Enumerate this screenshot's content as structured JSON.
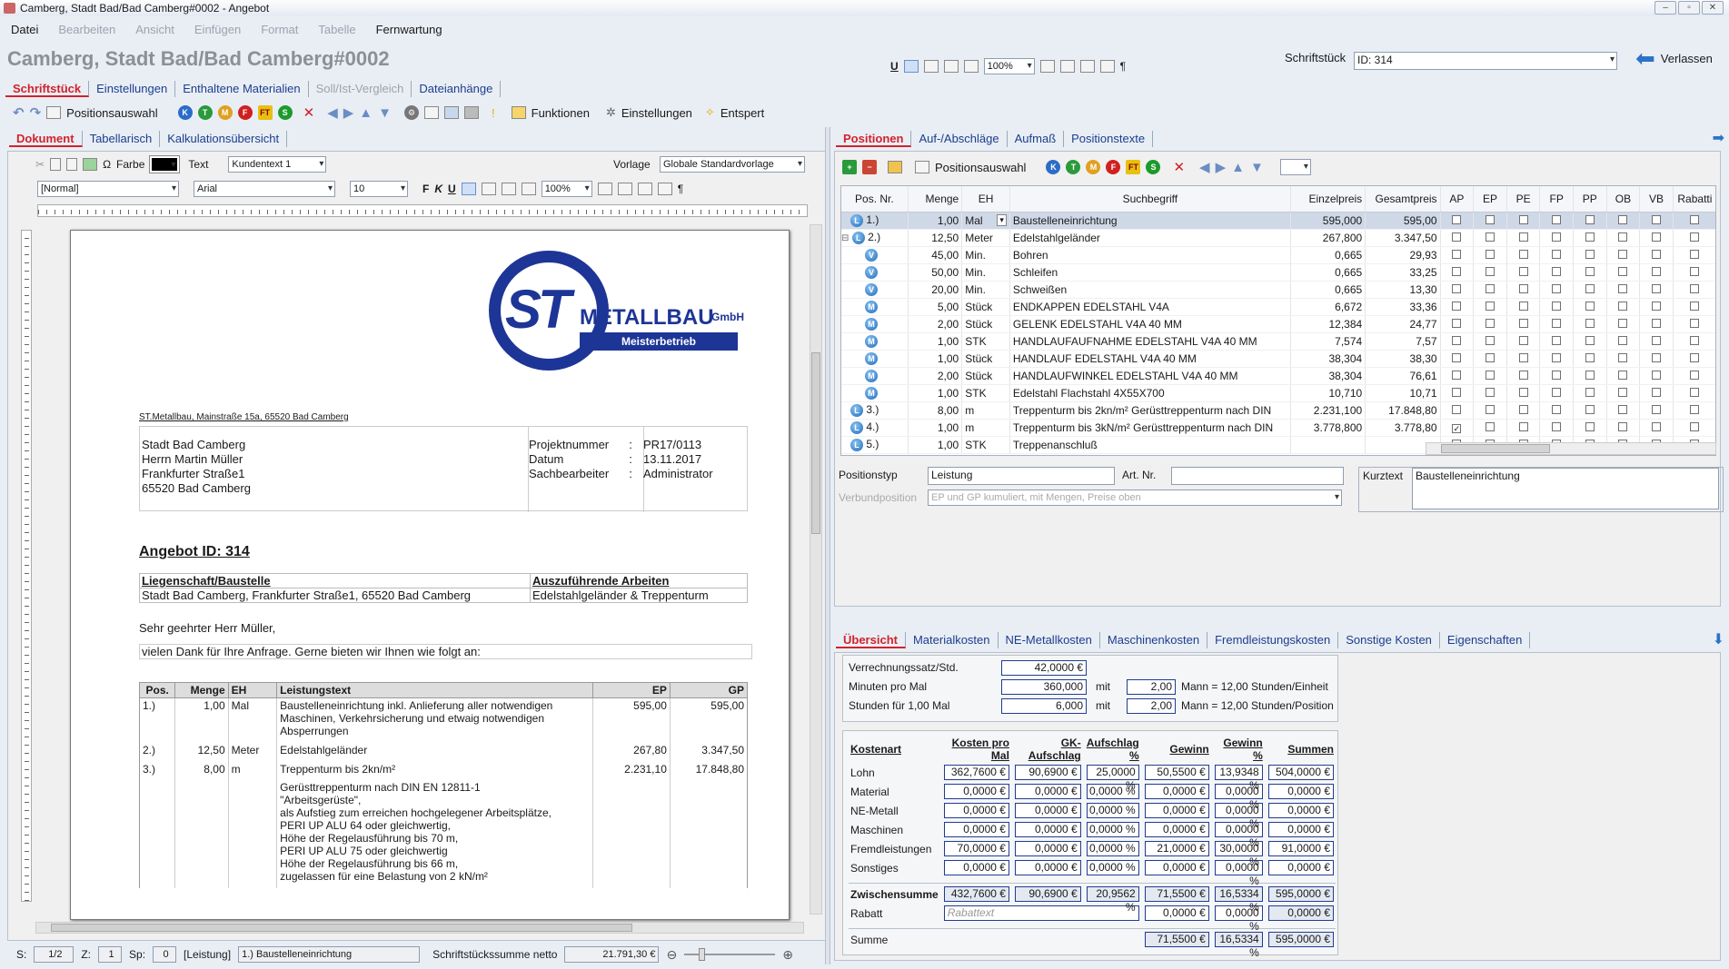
{
  "window": {
    "title": "Camberg, Stadt Bad/Bad Camberg#0002 - Angebot"
  },
  "menu": [
    {
      "label": "Datei",
      "enabled": true
    },
    {
      "label": "Bearbeiten",
      "enabled": false
    },
    {
      "label": "Ansicht",
      "enabled": false
    },
    {
      "label": "Einfügen",
      "enabled": false
    },
    {
      "label": "Format",
      "enabled": false
    },
    {
      "label": "Tabelle",
      "enabled": false
    },
    {
      "label": "Fernwartung",
      "enabled": true
    }
  ],
  "header": {
    "title": "Camberg, Stadt Bad/Bad Camberg#0002",
    "zoom": "100%",
    "schriftstueck_label": "Schriftstück",
    "schriftstueck_value": "ID: 314",
    "exit_label": "Verlassen"
  },
  "main_tabs": [
    {
      "label": "Schriftstück",
      "active": true
    },
    {
      "label": "Einstellungen"
    },
    {
      "label": "Enthaltene Materialien"
    },
    {
      "label": "Soll/Ist-Vergleich",
      "disabled": true
    },
    {
      "label": "Dateianhänge"
    }
  ],
  "toolbar": {
    "positionsauswahl": "Positionsauswahl",
    "funktionen": "Funktionen",
    "einstellungen": "Einstellungen",
    "entspert": "Entspert"
  },
  "left_tabs": [
    {
      "label": "Dokument",
      "active": true
    },
    {
      "label": "Tabellarisch"
    },
    {
      "label": "Kalkulationsübersicht"
    }
  ],
  "editor": {
    "farbe": "Farbe",
    "text": "Text",
    "text_value": "Kundentext 1",
    "vorlage": "Vorlage",
    "vorlage_value": "Globale Standardvorlage",
    "style": "[Normal]",
    "font": "Arial",
    "size": "10",
    "zoom": "100%"
  },
  "document": {
    "logo_main": "ST",
    "logo_company": "METALLBAU",
    "logo_gmbh": "GmbH",
    "logo_sub": "Meisterbetrieb",
    "sender": "ST.Metallbau, Mainstraße 15a, 65520 Bad Camberg",
    "address": [
      "Stadt Bad Camberg",
      "Herrn Martin Müller",
      "Frankfurter Straße1",
      "65520 Bad Camberg"
    ],
    "meta": [
      {
        "k": "Projektnummer",
        "v": "PR17/0113"
      },
      {
        "k": "Datum",
        "v": "13.11.2017"
      },
      {
        "k": "Sachbearbeiter",
        "v": "Administrator"
      }
    ],
    "heading": "Angebot ID: 314",
    "site_label": "Liegenschaft/Baustelle",
    "site_value": "Stadt Bad Camberg, Frankfurter Straße1, 65520 Bad Camberg",
    "work_label": "Auszuführende Arbeiten",
    "work_value": "Edelstahlgeländer & Treppenturm",
    "salutation": "Sehr geehrter Herr Müller,",
    "intro": "vielen Dank für Ihre Anfrage. Gerne bieten wir Ihnen wie folgt an:",
    "table_headers": [
      "Pos.",
      "Menge",
      "EH",
      "Leistungstext",
      "EP",
      "GP"
    ],
    "rows": [
      {
        "pos": "1.)",
        "menge": "1,00",
        "eh": "Mal",
        "text": "Baustelleneinrichtung inkl. Anlieferung aller notwendigen Maschinen, Verkehrsicherung und etwaig notwendigen Absperrungen",
        "ep": "595,00",
        "gp": "595,00"
      },
      {
        "pos": "2.)",
        "menge": "12,50",
        "eh": "Meter",
        "text": "Edelstahlgeländer",
        "ep": "267,80",
        "gp": "3.347,50"
      },
      {
        "pos": "3.)",
        "menge": "8,00",
        "eh": "m",
        "text": "Treppenturm bis 2kn/m²",
        "ep": "2.231,10",
        "gp": "17.848,80"
      }
    ],
    "row3_detail": [
      "Gerüsttreppenturm nach DIN EN 12811-1",
      "\"Arbeitsgerüste\",",
      "als Aufstieg zum erreichen hochgelegener Arbeitsplätze,",
      "PERI UP ALU 64 oder gleichwertig,",
      "Höhe der Regelausführung bis 70 m,",
      "PERI UP ALU 75 oder gleichwertig",
      "Höhe der Regelausführung bis 66 m,",
      "zugelassen für eine Belastung von 2 kN/m²"
    ]
  },
  "statusbar": {
    "s_label": "S:",
    "s": "1/2",
    "z_label": "Z:",
    "z": "1",
    "sp_label": "Sp:",
    "sp": "0",
    "type": "[Leistung]",
    "item": "1.) Baustelleneinrichtung",
    "sum_label": "Schriftstückssumme netto",
    "sum": "21.791,30 €"
  },
  "right_tabs": [
    {
      "label": "Positionen",
      "active": true
    },
    {
      "label": "Auf-/Abschläge"
    },
    {
      "label": "Aufmaß"
    },
    {
      "label": "Positionstexte"
    }
  ],
  "pos_toolbar": {
    "positionsauswahl": "Positionsauswahl"
  },
  "grid_headers": [
    "Pos. Nr.",
    "Menge",
    "EH",
    "Suchbegriff",
    "Einzelpreis",
    "Gesamtpreis",
    "AP",
    "EP",
    "PE",
    "FP",
    "PP",
    "OB",
    "VB",
    "Rabatti"
  ],
  "grid_rows": [
    {
      "icon": "L",
      "pos": "1.)",
      "menge": "1,00",
      "eh": "Mal",
      "such": "Baustelleneinrichtung",
      "ep": "595,000",
      "gp": "595,00",
      "checks": [
        0,
        0,
        0,
        0,
        0,
        0,
        0,
        0
      ],
      "sel": true,
      "level": 0
    },
    {
      "icon": "L",
      "pos": "2.)",
      "menge": "12,50",
      "eh": "Meter",
      "such": "Edelstahlgeländer",
      "ep": "267,800",
      "gp": "3.347,50",
      "checks": [
        0,
        0,
        0,
        0,
        0,
        0,
        0,
        0
      ],
      "level": 0,
      "expand": "⊟"
    },
    {
      "icon": "V",
      "pos": "",
      "menge": "45,00",
      "eh": "Min.",
      "such": "Bohren",
      "ep": "0,665",
      "gp": "29,93",
      "checks": [
        0,
        0,
        0,
        0,
        0,
        0,
        0,
        0
      ],
      "level": 1
    },
    {
      "icon": "V",
      "pos": "",
      "menge": "50,00",
      "eh": "Min.",
      "such": "Schleifen",
      "ep": "0,665",
      "gp": "33,25",
      "checks": [
        0,
        0,
        0,
        0,
        0,
        0,
        0,
        0
      ],
      "level": 1
    },
    {
      "icon": "V",
      "pos": "",
      "menge": "20,00",
      "eh": "Min.",
      "such": "Schweißen",
      "ep": "0,665",
      "gp": "13,30",
      "checks": [
        0,
        0,
        0,
        0,
        0,
        0,
        0,
        0
      ],
      "level": 1
    },
    {
      "icon": "M",
      "pos": "",
      "menge": "5,00",
      "eh": "Stück",
      "such": "ENDKAPPEN EDELSTAHL V4A",
      "ep": "6,672",
      "gp": "33,36",
      "checks": [
        0,
        0,
        0,
        0,
        0,
        0,
        0,
        0
      ],
      "level": 1
    },
    {
      "icon": "M",
      "pos": "",
      "menge": "2,00",
      "eh": "Stück",
      "such": "GELENK EDELSTAHL V4A 40 MM",
      "ep": "12,384",
      "gp": "24,77",
      "checks": [
        0,
        0,
        0,
        0,
        0,
        0,
        0,
        0
      ],
      "level": 1
    },
    {
      "icon": "M",
      "pos": "",
      "menge": "1,00",
      "eh": "STK",
      "such": "HANDLAUFAUFNAHME EDELSTAHL V4A 40 MM",
      "ep": "7,574",
      "gp": "7,57",
      "checks": [
        0,
        0,
        0,
        0,
        0,
        0,
        0,
        0
      ],
      "level": 1
    },
    {
      "icon": "M",
      "pos": "",
      "menge": "1,00",
      "eh": "Stück",
      "such": "HANDLAUF EDELSTAHL V4A 40 MM",
      "ep": "38,304",
      "gp": "38,30",
      "checks": [
        0,
        0,
        0,
        0,
        0,
        0,
        0,
        0
      ],
      "level": 1
    },
    {
      "icon": "M",
      "pos": "",
      "menge": "2,00",
      "eh": "Stück",
      "such": "HANDLAUFWINKEL EDELSTAHL V4A 40 MM",
      "ep": "38,304",
      "gp": "76,61",
      "checks": [
        0,
        0,
        0,
        0,
        0,
        0,
        0,
        0
      ],
      "level": 1
    },
    {
      "icon": "M",
      "pos": "",
      "menge": "1,00",
      "eh": "STK",
      "such": "Edelstahl Flachstahl 4X55X700",
      "ep": "10,710",
      "gp": "10,71",
      "checks": [
        0,
        0,
        0,
        0,
        0,
        0,
        0,
        0
      ],
      "level": 1
    },
    {
      "icon": "L",
      "pos": "3.)",
      "menge": "8,00",
      "eh": "m",
      "such": "Treppenturm bis 2kn/m²  Gerüsttreppenturm nach DIN",
      "ep": "2.231,100",
      "gp": "17.848,80",
      "checks": [
        0,
        0,
        0,
        0,
        0,
        0,
        0,
        0
      ],
      "level": 0
    },
    {
      "icon": "L",
      "pos": "4.)",
      "menge": "1,00",
      "eh": "m",
      "such": "Treppenturm bis 3kN/m² Gerüsttreppenturm nach DIN",
      "ep": "3.778,800",
      "gp": "3.778,80",
      "checks": [
        1,
        0,
        0,
        0,
        0,
        0,
        0,
        0
      ],
      "level": 0
    },
    {
      "icon": "L",
      "pos": "5.)",
      "menge": "1,00",
      "eh": "STK",
      "such": "Treppenanschluß",
      "ep": "",
      "gp": "",
      "checks": [
        0,
        0,
        0,
        0,
        0,
        0,
        0,
        0
      ],
      "level": 0
    }
  ],
  "pos_details": {
    "positionstyp_label": "Positionstyp",
    "positionstyp": "Leistung",
    "artnr_label": "Art. Nr.",
    "artnr": "",
    "kurztext_label": "Kurztext",
    "kurztext": "Baustelleneinrichtung",
    "verbund_label": "Verbundposition",
    "verbund_value": "EP und GP kumuliert, mit Mengen, Preise oben"
  },
  "bottom_tabs": [
    {
      "label": "Übersicht",
      "active": true
    },
    {
      "label": "Materialkosten"
    },
    {
      "label": "NE-Metallkosten"
    },
    {
      "label": "Maschinenkosten"
    },
    {
      "label": "Fremdleistungskosten"
    },
    {
      "label": "Sonstige Kosten"
    },
    {
      "label": "Eigenschaften"
    }
  ],
  "overview": {
    "vs_label": "Verrechnungssatz/Std.",
    "vs": "42,0000 €",
    "min_label": "Minuten pro Mal",
    "min": "360,000",
    "mit": "mit",
    "min_mann": "2,00",
    "min_text": "Mann = 12,00 Stunden/Einheit",
    "std_label": "Stunden für 1,00 Mal",
    "std": "6,000",
    "std_mann": "2,00",
    "std_text": "Mann = 12,00 Stunden/Position",
    "cost_headers": [
      "Kostenart",
      "Kosten pro Mal",
      "GK-Aufschlag",
      "Aufschlag %",
      "Gewinn",
      "Gewinn %",
      "Summen"
    ],
    "cost_rows": [
      {
        "name": "Lohn",
        "v": [
          "362,7600 €",
          "90,6900 €",
          "25,0000 %",
          "50,5500 €",
          "13,9348 %",
          "504,0000 €"
        ]
      },
      {
        "name": "Material",
        "v": [
          "0,0000 €",
          "0,0000 €",
          "0,0000 %",
          "0,0000 €",
          "0,0000 %",
          "0,0000 €"
        ]
      },
      {
        "name": "NE-Metall",
        "v": [
          "0,0000 €",
          "0,0000 €",
          "0,0000 %",
          "0,0000 €",
          "0,0000 %",
          "0,0000 €"
        ]
      },
      {
        "name": "Maschinen",
        "v": [
          "0,0000 €",
          "0,0000 €",
          "0,0000 %",
          "0,0000 €",
          "0,0000 %",
          "0,0000 €"
        ]
      },
      {
        "name": "Fremdleistungen",
        "v": [
          "70,0000 €",
          "0,0000 €",
          "0,0000 %",
          "21,0000 €",
          "30,0000 %",
          "91,0000 €"
        ]
      },
      {
        "name": "Sonstiges",
        "v": [
          "0,0000 €",
          "0,0000 €",
          "0,0000 %",
          "0,0000 €",
          "0,0000 %",
          "0,0000 €"
        ]
      }
    ],
    "zwischen_label": "Zwischensumme",
    "zwischen": [
      "432,7600 €",
      "90,6900 €",
      "20,9562 %",
      "71,5500 €",
      "16,5334 %",
      "595,0000 €"
    ],
    "rabatt_label": "Rabatt",
    "rabatt_placeholder": "Rabattext",
    "rabatt": [
      "0,0000 €",
      "0,0000 %",
      "0,0000 €"
    ],
    "summe_label": "Summe",
    "summe": [
      "71,5500 €",
      "16,5334 %",
      "595,0000 €"
    ]
  }
}
